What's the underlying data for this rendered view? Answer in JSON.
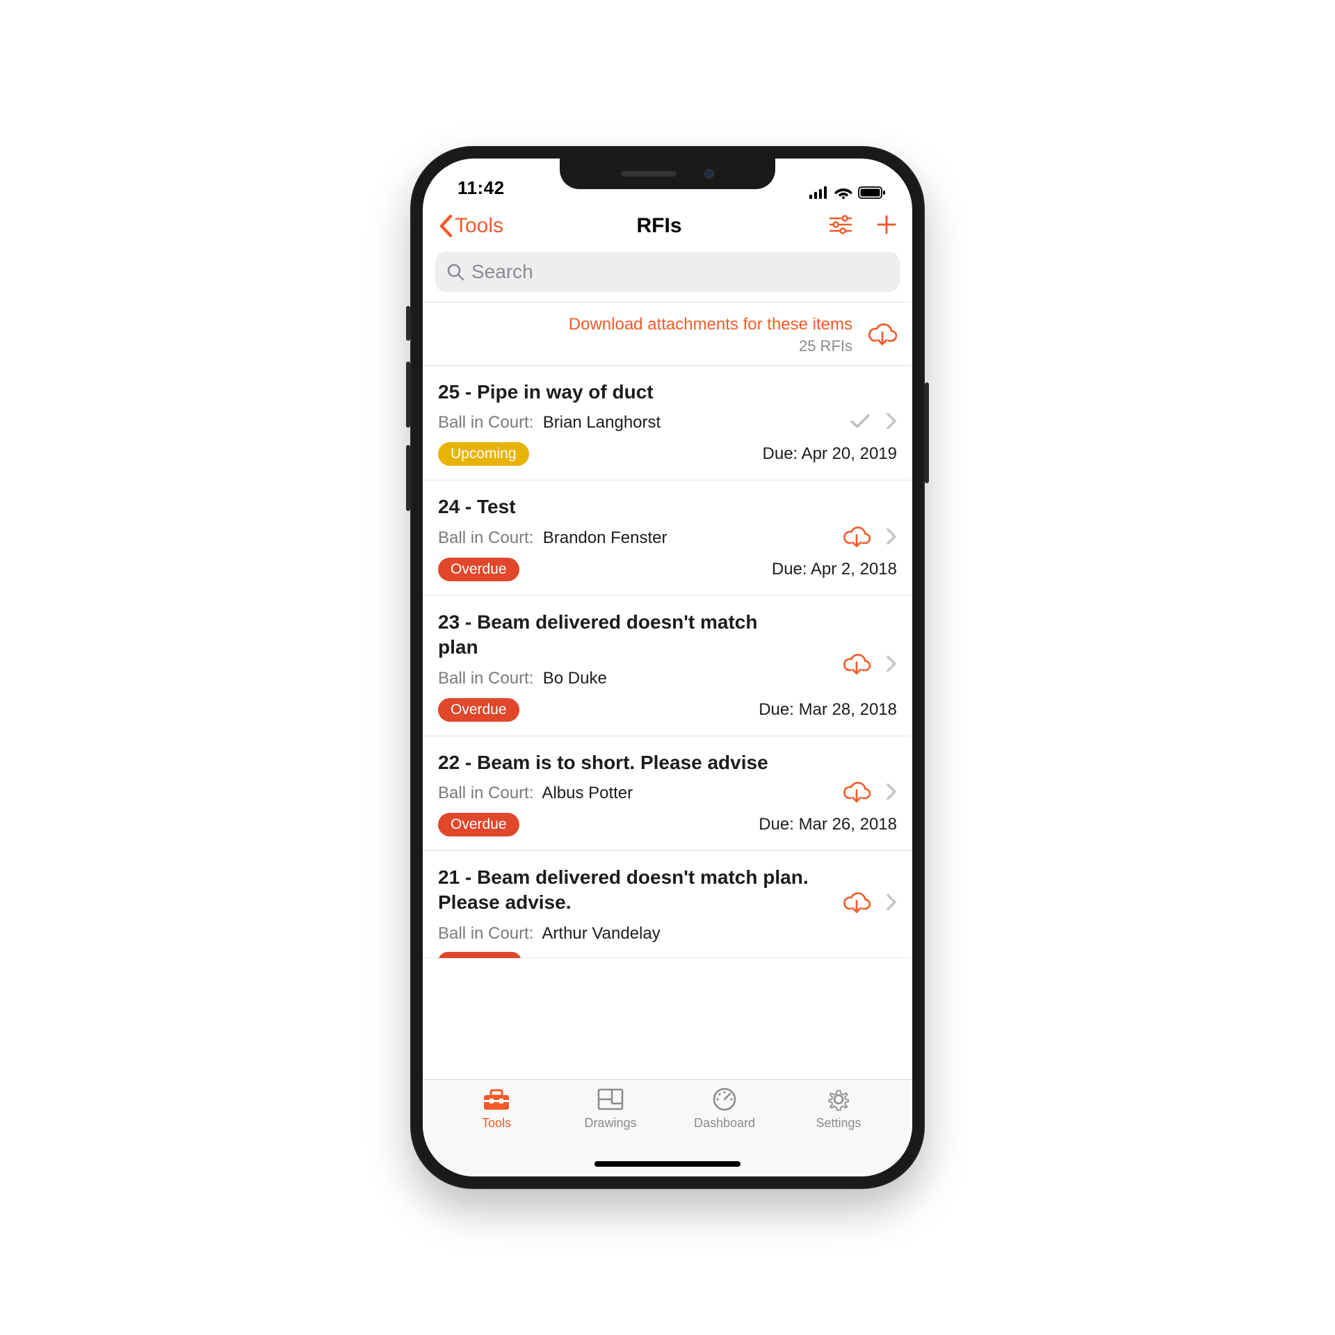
{
  "status": {
    "time": "11:42"
  },
  "nav": {
    "back_label": "Tools",
    "title": "RFIs"
  },
  "search": {
    "placeholder": "Search"
  },
  "banner": {
    "line1": "Download attachments for these items",
    "line2": "25 RFIs"
  },
  "items": [
    {
      "title": "25 - Pipe in way of duct",
      "bic_label": "Ball in Court:",
      "bic_value": "Brian Langhorst",
      "badge_text": "Upcoming",
      "badge_kind": "upcoming",
      "due": "Due: Apr 20, 2019",
      "icon": "check"
    },
    {
      "title": "24 - Test",
      "bic_label": "Ball in Court:",
      "bic_value": "Brandon Fenster",
      "badge_text": "Overdue",
      "badge_kind": "overdue",
      "due": "Due: Apr 2, 2018",
      "icon": "cloud"
    },
    {
      "title": "23 - Beam delivered doesn't match plan",
      "bic_label": "Ball in Court:",
      "bic_value": "Bo Duke",
      "badge_text": "Overdue",
      "badge_kind": "overdue",
      "due": "Due: Mar 28, 2018",
      "icon": "cloud"
    },
    {
      "title": "22 - Beam is to short. Please advise",
      "bic_label": "Ball in Court:",
      "bic_value": "Albus Potter",
      "badge_text": "Overdue",
      "badge_kind": "overdue",
      "due": "Due: Mar 26, 2018",
      "icon": "cloud"
    },
    {
      "title": "21 - Beam delivered doesn't match plan. Please advise.",
      "bic_label": "Ball in Court:",
      "bic_value": "Arthur Vandelay",
      "badge_text": "",
      "badge_kind": "overdue",
      "due": "",
      "icon": "cloud"
    }
  ],
  "tabs": [
    {
      "label": "Tools",
      "active": true
    },
    {
      "label": "Drawings",
      "active": false
    },
    {
      "label": "Dashboard",
      "active": false
    },
    {
      "label": "Settings",
      "active": false
    }
  ]
}
